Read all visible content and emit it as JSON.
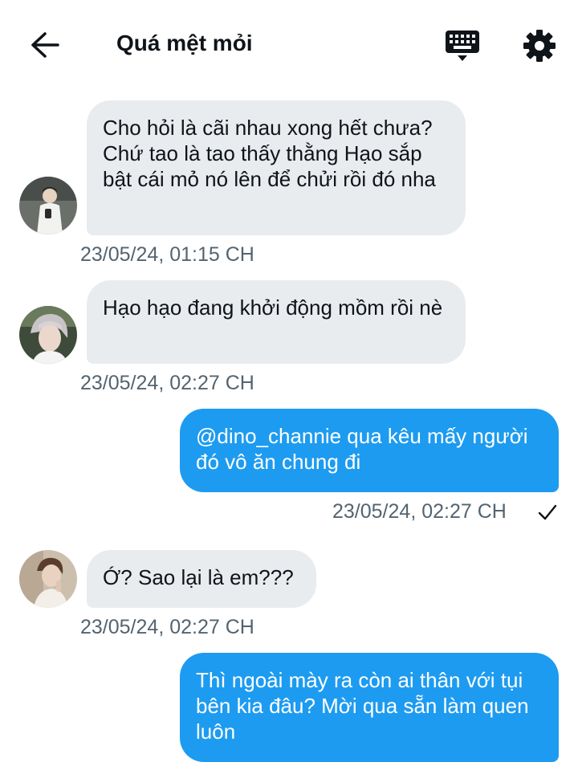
{
  "header": {
    "title": "Quá mệt mỏi",
    "back_icon": "arrow-left-icon",
    "keyboard_icon": "keyboard-icon",
    "settings_icon": "gear-icon"
  },
  "messages": [
    {
      "direction": "incoming",
      "text": "Cho hỏi là cãi nhau xong hết chưa? Chứ tao là tao thấy thằng Hạo sắp bật cái mỏ nó lên để chửi rồi đó nha",
      "timestamp": "23/05/24, 01:15 CH"
    },
    {
      "direction": "incoming",
      "text": "Hạo hạo đang khởi động mồm rồi nè",
      "timestamp": "23/05/24, 02:27 CH"
    },
    {
      "direction": "outgoing",
      "text": "@dino_channie qua kêu mấy người đó vô ăn chung đi",
      "timestamp": "23/05/24, 02:27 CH",
      "status": "sent-check"
    },
    {
      "direction": "incoming",
      "text": "Ớ? Sao lại là em???",
      "timestamp": "23/05/24, 02:27 CH"
    },
    {
      "direction": "outgoing",
      "text": "Thì ngoài mày ra còn ai thân với tụi bên kia đâu? Mời qua sẵn làm quen luôn",
      "timestamp": ""
    }
  ],
  "colors": {
    "outgoing_bubble": "#1d9bf0",
    "incoming_bubble": "#e9ecef",
    "timestamp": "#536471"
  }
}
